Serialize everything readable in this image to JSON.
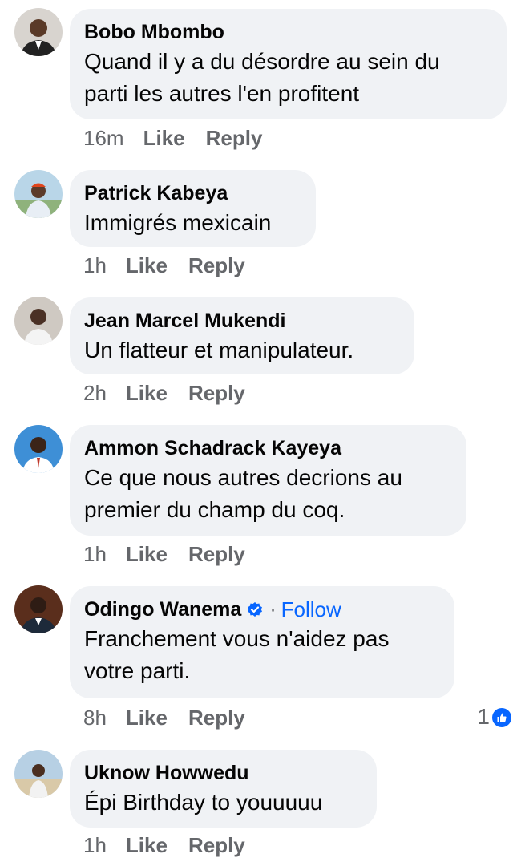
{
  "actions": {
    "like": "Like",
    "reply": "Reply"
  },
  "colors": {
    "bubble": "#f0f2f5",
    "secondary_text": "#65676b",
    "link_blue": "#0866ff",
    "verified_blue": "#0866ff"
  },
  "comments": [
    {
      "author": "Bobo Mbombo",
      "text_lines": [
        "Quand il y a du désordre au sein du",
        "parti les autres l'en profitent"
      ],
      "time": "16m"
    },
    {
      "author": "Patrick Kabeya",
      "text_lines": [
        "Immigrés mexicain"
      ],
      "time": "1h"
    },
    {
      "author": "Jean Marcel Mukendi",
      "text_lines": [
        "Un flatteur et manipulateur."
      ],
      "time": "2h"
    },
    {
      "author": "Ammon Schadrack Kayeya",
      "text_lines": [
        "Ce que nous autres decrions au",
        "premier du champ du coq."
      ],
      "time": "1h"
    },
    {
      "author": "Odingo Wanema",
      "verified": true,
      "separator": "·",
      "follow_label": "Follow",
      "text_lines": [
        "Franchement vous n'aidez pas",
        "votre parti."
      ],
      "time": "8h",
      "reaction_count": "1",
      "reaction_icon": "thumbs-up-icon"
    },
    {
      "author": "Uknow Howwedu",
      "text_lines": [
        "Épi Birthday to youuuuu"
      ],
      "time": "1h"
    }
  ]
}
